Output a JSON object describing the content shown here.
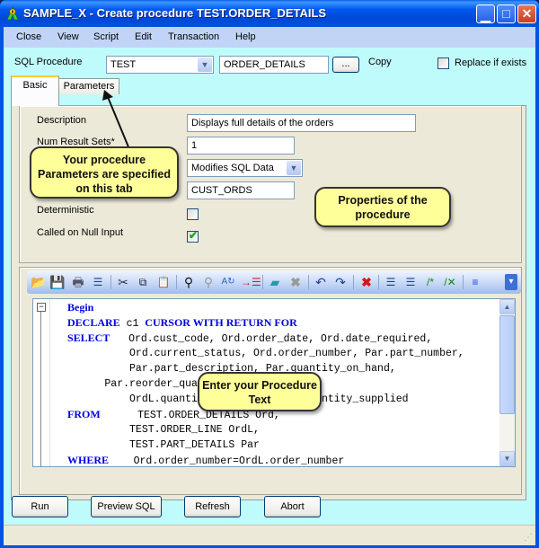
{
  "window": {
    "title": "SAMPLE_X - Create procedure TEST.ORDER_DETAILS",
    "app_icon": "dbvisual-app-icon",
    "controls": {
      "minimize": "_",
      "maximize": "□",
      "close": "✕"
    }
  },
  "menubar": {
    "items": [
      {
        "label": "Close"
      },
      {
        "label": "View"
      },
      {
        "label": "Script"
      },
      {
        "label": "Edit"
      },
      {
        "label": "Transaction"
      },
      {
        "label": "Help"
      }
    ]
  },
  "header": {
    "sql_procedure_label": "SQL Procedure",
    "schema_value": "TEST",
    "procedure_name_value": "ORDER_DETAILS",
    "browse_button": "...",
    "copy_label": "Copy",
    "replace_if_exists_label": "Replace if exists",
    "replace_if_exists_checked": false
  },
  "tabs": [
    {
      "label": "Basic",
      "active": true
    },
    {
      "label": "Parameters",
      "active": false
    }
  ],
  "properties": {
    "description_label": "Description",
    "description_value": "Displays full details of the orders",
    "num_result_sets_label": "Num Result Sets*",
    "num_result_sets_value": "1",
    "sql_data_access_value": "Modifies SQL Data",
    "specific_name_value": "CUST_ORDS",
    "deterministic_label": "Deterministic",
    "deterministic_checked": false,
    "called_on_null_label": "Called on Null Input",
    "called_on_null_checked": true
  },
  "toolbar": {
    "icons": [
      "open-folder-icon",
      "save-icon",
      "print-icon",
      "numbered-list-icon",
      "cut-icon",
      "copy-icon",
      "paste-icon",
      "find-icon",
      "find-next-icon",
      "replace-icon",
      "goto-line-icon",
      "eraser-icon",
      "delete-icon",
      "undo-icon",
      "redo-icon",
      "clear-icon",
      "indent-icon",
      "outdent-icon",
      "comment-icon",
      "uncomment-icon",
      "align-left-icon",
      "toolbar-overflow-icon"
    ]
  },
  "editor": {
    "lines": [
      [
        {
          "t": "Begin",
          "k": true
        }
      ],
      [
        {
          "t": "DECLARE",
          "k": true
        },
        {
          "t": " c1 "
        },
        {
          "t": "CURSOR WITH RETURN FOR",
          "k": true
        }
      ],
      [
        {
          "t": "SELECT",
          "k": true
        },
        {
          "t": "   Ord.cust_code, Ord.order_date, Ord.date_required,"
        }
      ],
      [
        {
          "t": "          Ord.current_status, Ord.order_number, Par.part_number,"
        }
      ],
      [
        {
          "t": "          Par.part_description, Par.quantity_on_hand,"
        }
      ],
      [
        {
          "t": "      Par.reorder_quantity,"
        }
      ],
      [
        {
          "t": "          OrdL.quantity_ordered, OrdL.quantity_supplied"
        }
      ],
      [
        {
          "t": "FROM",
          "k": true
        },
        {
          "t": "      TEST.ORDER_DETAILS Ord,"
        }
      ],
      [
        {
          "t": "          TEST.ORDER_LINE OrdL,"
        }
      ],
      [
        {
          "t": "          TEST.PART_DETAILS Par"
        }
      ],
      [
        {
          "t": "WHERE",
          "k": true
        },
        {
          "t": "    Ord.order_number=OrdL.order_number"
        }
      ]
    ]
  },
  "callouts": {
    "parameters_tab": "Your procedure Parameters are specified on this tab",
    "properties": "Properties of the procedure",
    "procedure_text": "Enter your Procedure Text"
  },
  "buttons": {
    "run": "Run",
    "preview_sql": "Preview SQL",
    "refresh": "Refresh",
    "abort": "Abort"
  },
  "colors": {
    "client_bg": "#c0fbfb",
    "panel_bg": "#ece9d8",
    "keyword": "#0000e0",
    "callout_bg": "#ffff99",
    "titlebar": "#0054e3"
  }
}
